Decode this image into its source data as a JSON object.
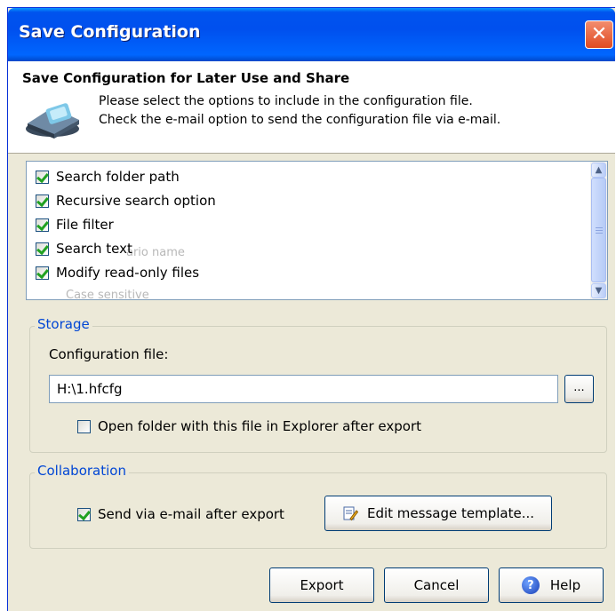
{
  "window": {
    "title": "Save Configuration",
    "close_glyph": "✕"
  },
  "header": {
    "title": "Save Configuration for Later Use and Share",
    "line1": "Please select the options to include in the configuration file.",
    "line2": "Check the e-mail option to send the configuration file via e-mail.",
    "icon": "configuration-icon"
  },
  "options_list": {
    "items": [
      {
        "label": "Search folder path",
        "checked": true
      },
      {
        "label": "Recursive search option",
        "checked": true
      },
      {
        "label": "File filter",
        "checked": true
      },
      {
        "label": "Search text",
        "checked": true
      },
      {
        "label": "Modify read-only files",
        "checked": true
      }
    ],
    "ghost_text": [
      "ario name",
      "Case sensitive"
    ],
    "scroll_up_glyph": "▲",
    "scroll_down_glyph": "▼"
  },
  "storage": {
    "group_label": "Storage",
    "config_label": "Configuration file:",
    "config_value": "H:\\1.hfcfg",
    "browse_label": "...",
    "open_folder_label": "Open folder with this file in Explorer after export",
    "open_folder_checked": false
  },
  "collaboration": {
    "group_label": "Collaboration",
    "send_email_label": "Send via e-mail after export",
    "send_email_checked": true,
    "edit_template_label": "Edit message template...",
    "edit_template_icon": "edit-document-icon"
  },
  "buttons": {
    "export": "Export",
    "cancel": "Cancel",
    "help": "Help",
    "help_glyph": "?"
  },
  "colors": {
    "titlebar": "#0054e3",
    "group_label": "#0046d5",
    "check": "#21a121",
    "dialog_bg": "#ece9d8"
  }
}
